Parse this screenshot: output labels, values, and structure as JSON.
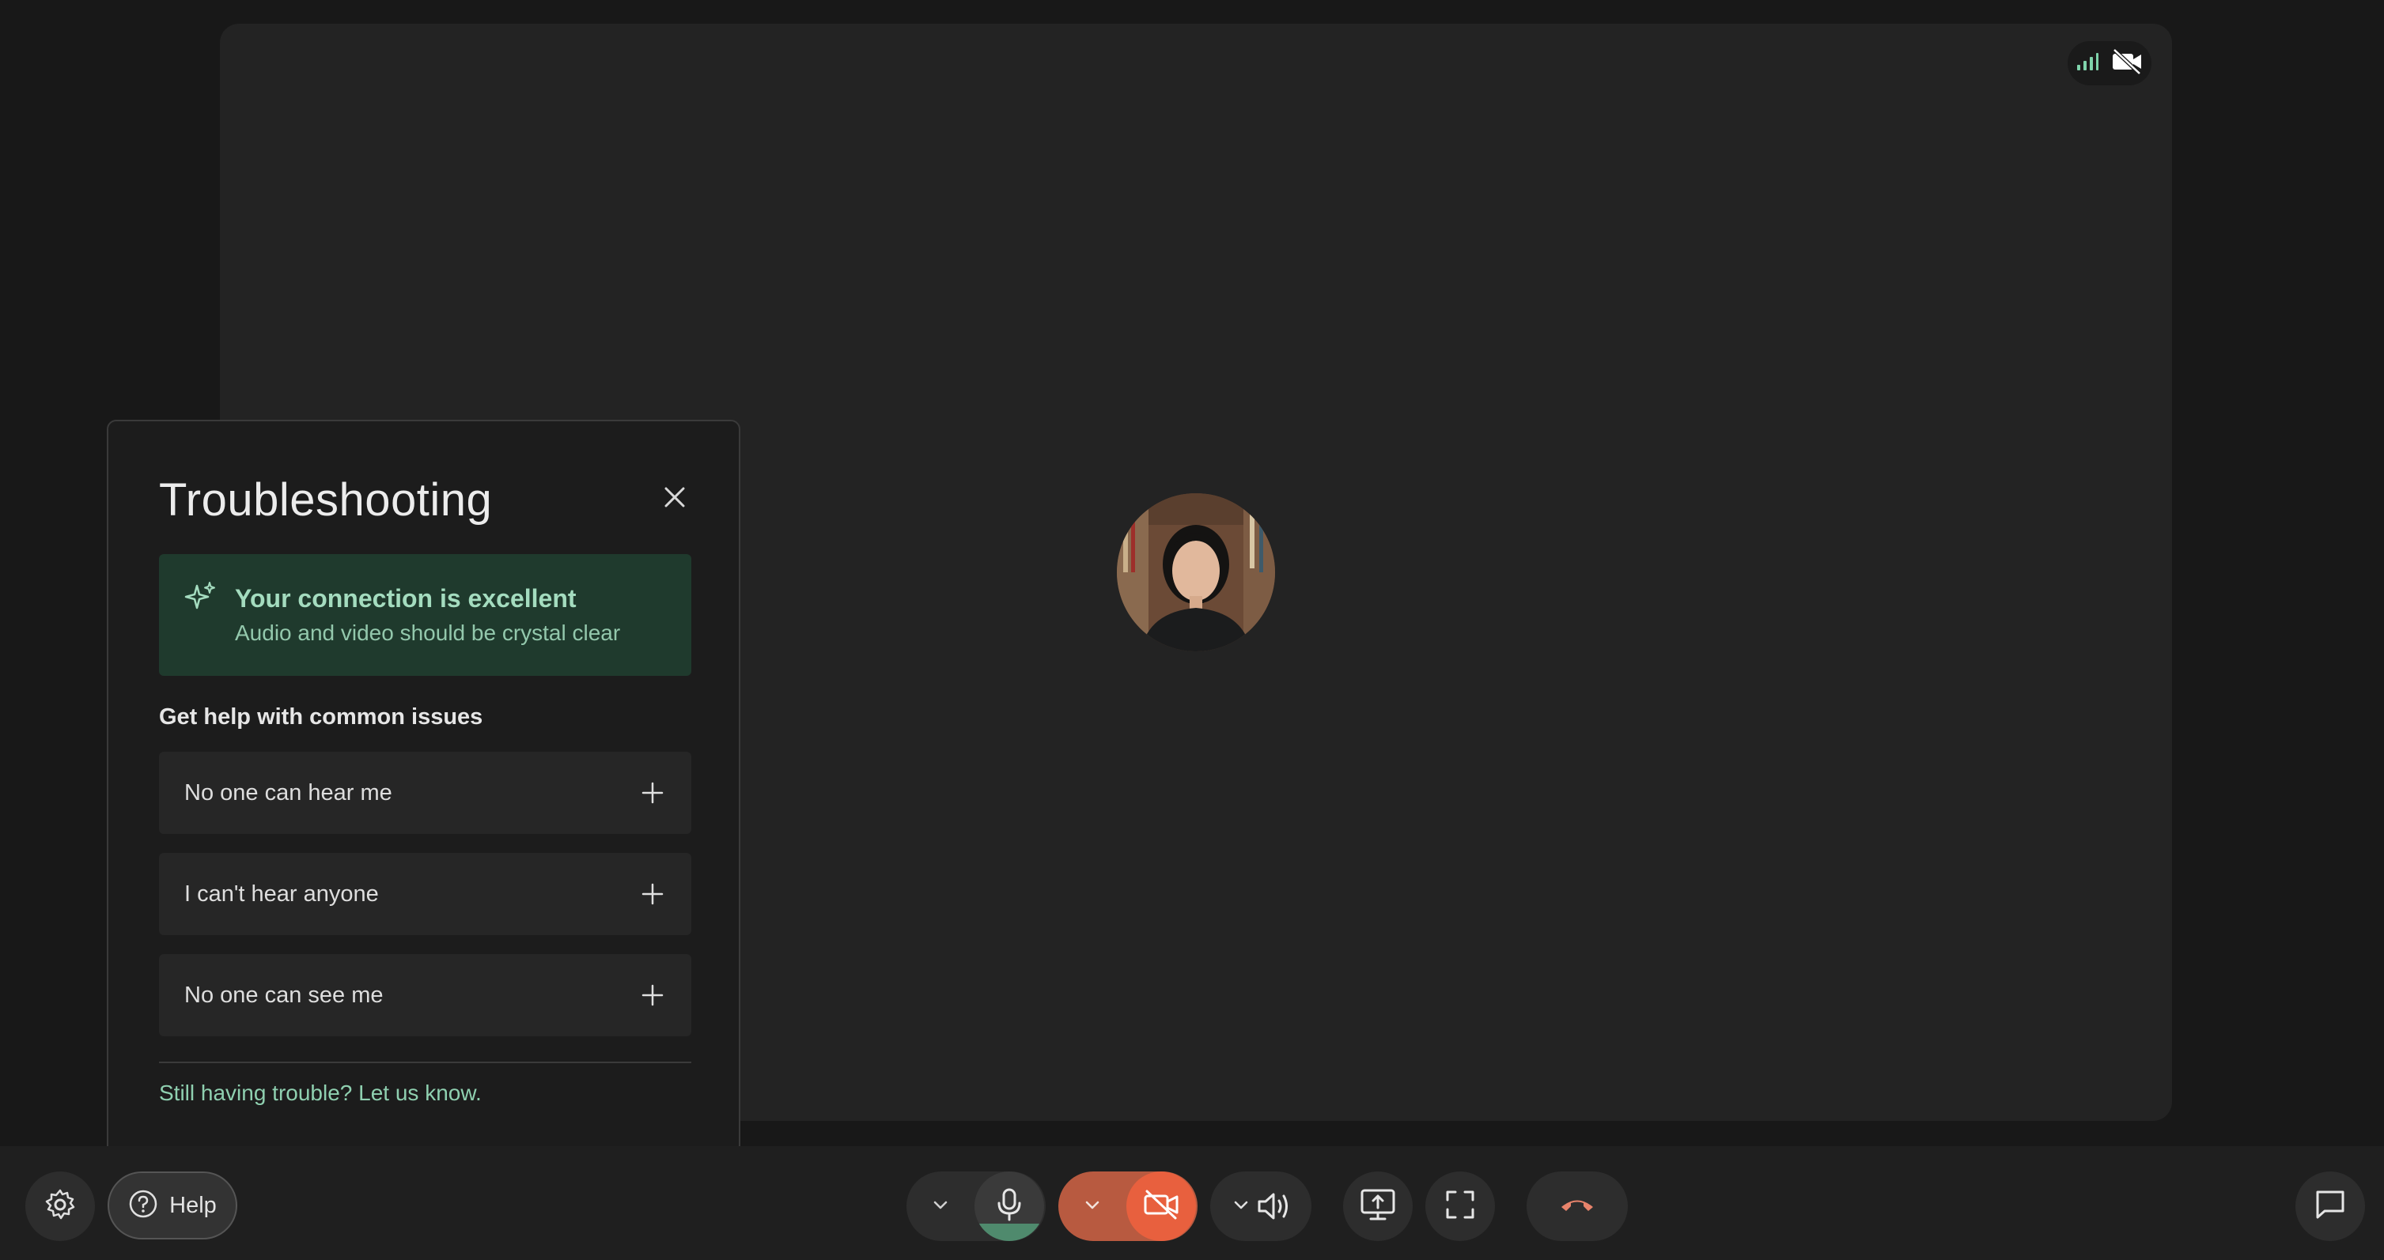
{
  "panel": {
    "title": "Troubleshooting",
    "connection": {
      "title": "Your connection is excellent",
      "subtitle": "Audio and video should be crystal clear"
    },
    "issues_heading": "Get help with common issues",
    "issues": [
      {
        "label": "No one can hear me"
      },
      {
        "label": "I can't hear anyone"
      },
      {
        "label": "No one can see me"
      }
    ],
    "footer_link": "Still having trouble? Let us know."
  },
  "toolbar": {
    "help_label": "Help",
    "mic_level": 0.25
  },
  "colors": {
    "accent_green": "#a4dcbf",
    "connection_bg": "#1f3a2d",
    "camera_off": "#e8603e",
    "hangup": "#e8836b"
  },
  "icons": {
    "status": [
      "signal-bars-icon",
      "video-off-icon"
    ],
    "toolbar": [
      "gear-icon",
      "help-circle-icon",
      "chevron-down-icon",
      "microphone-icon",
      "video-off-icon",
      "speaker-icon",
      "screen-share-icon",
      "fullscreen-icon",
      "hang-up-icon",
      "chat-icon"
    ]
  }
}
